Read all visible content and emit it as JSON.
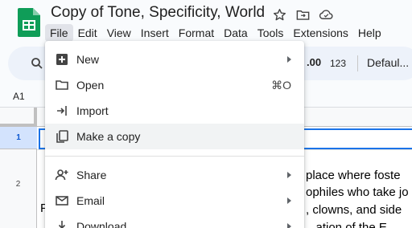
{
  "header": {
    "doc_title": "Copy of Tone, Specificity, World",
    "star_icon": "star-icon",
    "move_icon": "folder-move-icon",
    "cloud_icon": "cloud-done-icon"
  },
  "menubar": [
    "File",
    "Edit",
    "View",
    "Insert",
    "Format",
    "Data",
    "Tools",
    "Extensions",
    "Help"
  ],
  "active_menu": "File",
  "toolbar": {
    "decimal_label": ".00",
    "number_format_label": "123",
    "font_label": "Defaul..."
  },
  "formula_bar": {
    "name_box": "A1"
  },
  "grid": {
    "row_1": "1",
    "row_2": "2",
    "cell_lines": [
      "place where foste",
      "ophiles who take jo",
      ", clowns, and side",
      "...ation of the E..."
    ],
    "left_fragment": "F"
  },
  "file_menu": {
    "items": [
      {
        "label": "New",
        "icon": "new-sheet-icon",
        "submenu": true
      },
      {
        "label": "Open",
        "icon": "folder-open-icon",
        "shortcut": "⌘O"
      },
      {
        "label": "Import",
        "icon": "import-icon"
      },
      {
        "label": "Make a copy",
        "icon": "copy-icon"
      },
      {
        "label": "Share",
        "icon": "person-add-icon",
        "submenu": true
      },
      {
        "label": "Email",
        "icon": "email-icon",
        "submenu": true
      },
      {
        "label": "Download",
        "icon": "download-icon",
        "submenu": true
      }
    ]
  },
  "colors": {
    "accent": "#1a73e8",
    "sheets_green": "#0f9d58",
    "toolbar_bg": "#edf2fa",
    "selected_row_header": "#d3e3fd"
  }
}
